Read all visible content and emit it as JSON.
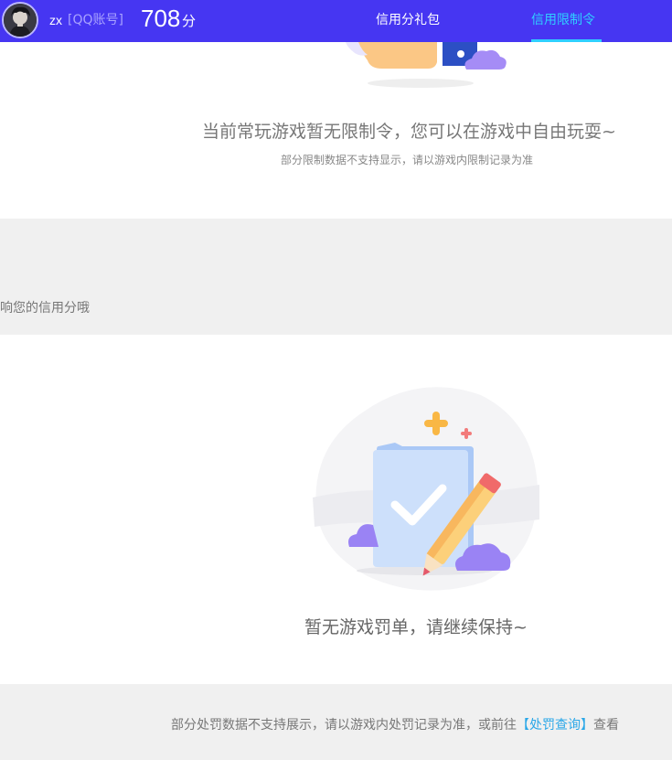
{
  "header": {
    "username": "zx",
    "account_type": "[QQ账号]",
    "score": "708",
    "score_unit": "分",
    "tabs": [
      {
        "label": "信用分礼包",
        "active": false
      },
      {
        "label": "信用限制令",
        "active": true
      }
    ],
    "colors": {
      "bar": "#4636f2",
      "active_tab": "#2fd0ff"
    }
  },
  "limits": {
    "message": "当前常玩游戏暂无限制令，您可以在游戏中自由玩耍~",
    "note": "部分限制数据不支持显示，请以游戏内限制记录为准"
  },
  "band": {
    "text": "响您的信用分哦"
  },
  "penalties": {
    "message": "暂无游戏罚单，请继续保持~"
  },
  "footer": {
    "prefix": "部分处罚数据不支持展示，请以游戏内处罚记录为准，或前往",
    "link": "【处罚查询】",
    "suffix": "查看",
    "link_color": "#2aa7e8"
  }
}
